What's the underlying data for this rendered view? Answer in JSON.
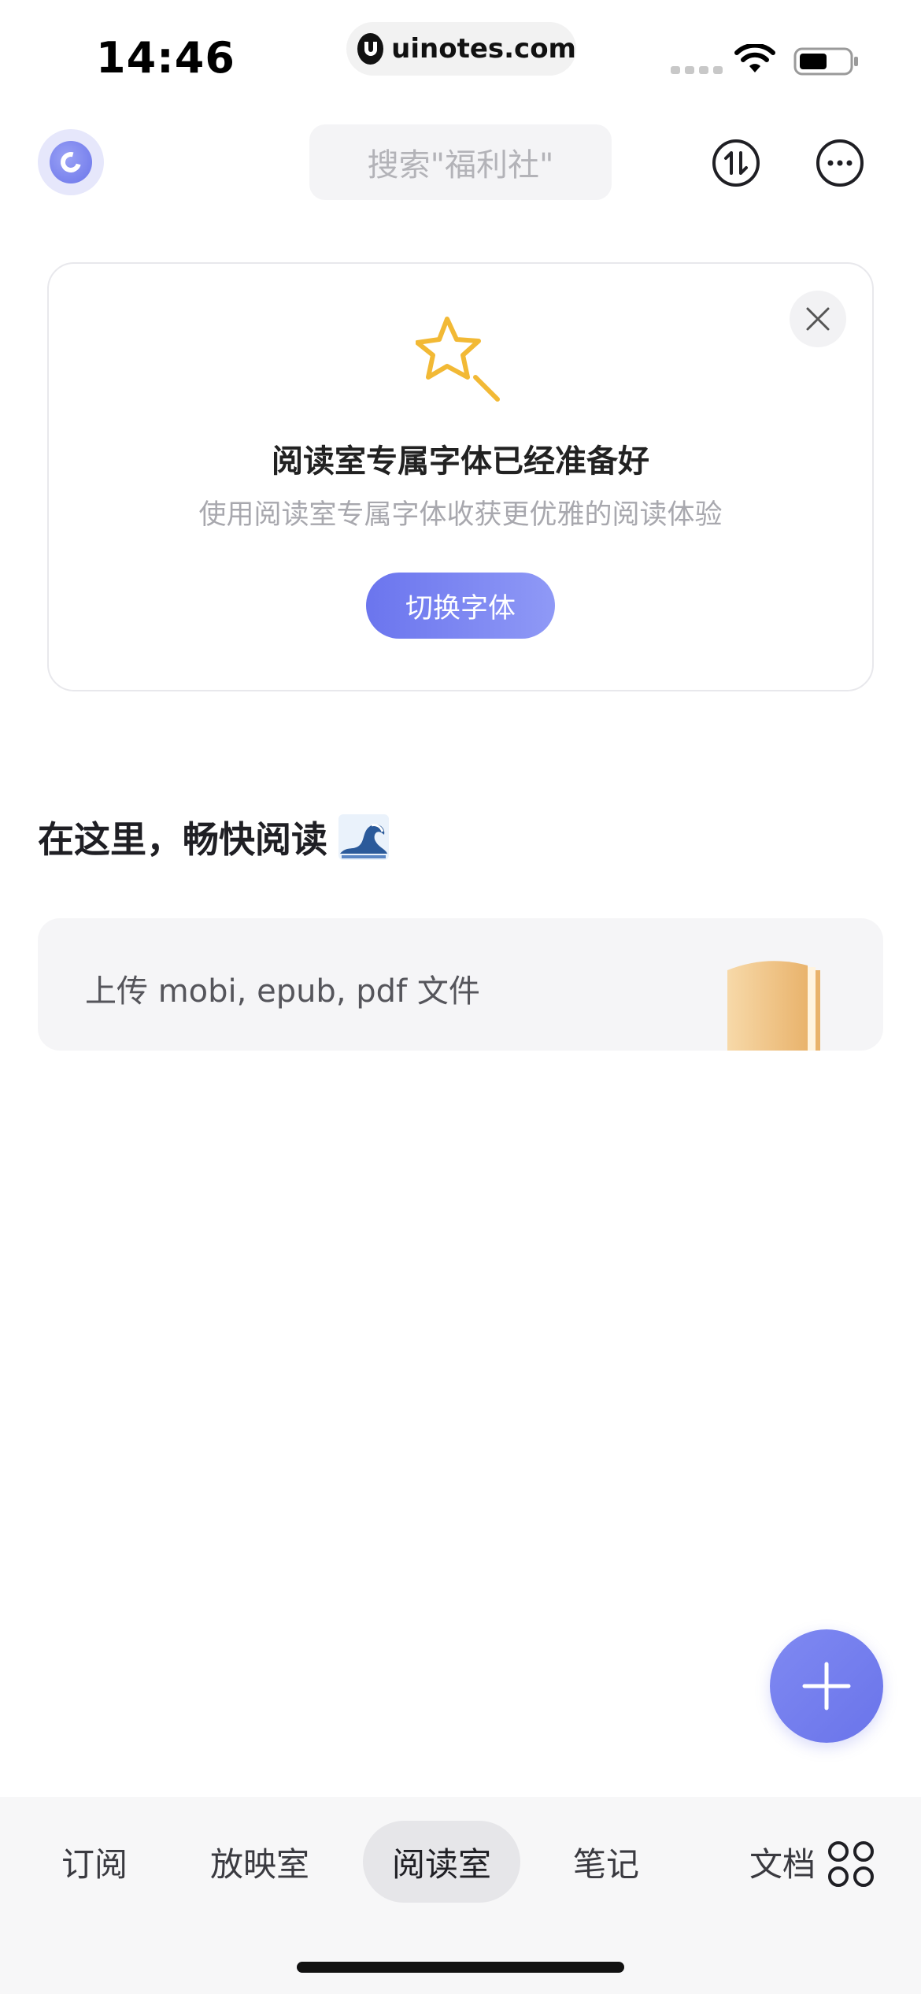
{
  "status_bar": {
    "time": "14:46",
    "url": "uinotes.com",
    "icons": [
      "cellular-dots-icon",
      "wifi-icon",
      "battery-icon"
    ]
  },
  "header": {
    "logo_icon": "app-logo-icon",
    "search_placeholder": "搜索\"福利社\"",
    "icons": [
      "sort-icon",
      "more-icon"
    ]
  },
  "font_card": {
    "icon": "magic-wand-star-icon",
    "title": "阅读室专属字体已经准备好",
    "subtitle": "使用阅读室专属字体收获更优雅的阅读体验",
    "button_label": "切换字体",
    "close_icon": "close-icon"
  },
  "section": {
    "title": "在这里，畅快阅读",
    "emoji_icon": "wave-icon"
  },
  "upload": {
    "label": "上传 mobi, epub, pdf 文件",
    "icon": "book-icon"
  },
  "fab": {
    "icon": "plus-icon"
  },
  "bottom_nav": {
    "tabs": [
      {
        "label": "订阅",
        "active": false
      },
      {
        "label": "放映室",
        "active": false
      },
      {
        "label": "阅读室",
        "active": true
      },
      {
        "label": "笔记",
        "active": false
      },
      {
        "label": "文档",
        "active": false
      }
    ],
    "more_icon": "grid-icon"
  },
  "colors": {
    "accent": "#6B75EE",
    "star": "#F2B935",
    "background": "#FFFFFF",
    "nav_background": "#F7F7F8"
  }
}
